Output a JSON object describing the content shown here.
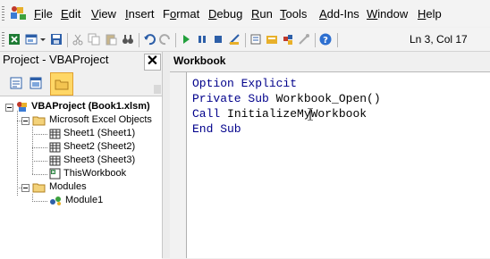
{
  "menubar": {
    "items": [
      {
        "accel": "F",
        "rest": "ile"
      },
      {
        "accel": "E",
        "rest": "dit"
      },
      {
        "accel": "V",
        "rest": "iew"
      },
      {
        "accel": "I",
        "rest": "nsert"
      },
      {
        "prefix": "F",
        "accel": "o",
        "rest": "rmat"
      },
      {
        "accel": "D",
        "rest": "ebug"
      },
      {
        "accel": "R",
        "rest": "un"
      },
      {
        "accel": "T",
        "rest": "ools"
      },
      {
        "prefix": "",
        "accel": "A",
        "rest": "dd-Ins"
      },
      {
        "accel": "W",
        "rest": "indow"
      },
      {
        "accel": "H",
        "rest": "elp"
      }
    ]
  },
  "toolbar": {
    "icons": [
      "excel-icon",
      "insert-userform-icon",
      "dropdown-arrow-icon",
      "save-icon",
      "cut-icon",
      "copy-icon",
      "paste-icon",
      "find-icon",
      "undo-icon",
      "redo-icon",
      "run-icon",
      "break-icon",
      "reset-icon",
      "design-mode-icon",
      "project-explorer-icon",
      "properties-icon",
      "object-browser-icon",
      "toolbox-icon",
      "help-icon"
    ],
    "position": "Ln 3, Col 17"
  },
  "project": {
    "title": "Project - VBAProject",
    "close": "✕",
    "tree": {
      "root": "VBAProject (Book1.xlsm)",
      "excel_objects": "Microsoft Excel Objects",
      "sheets": [
        "Sheet1 (Sheet1)",
        "Sheet2 (Sheet2)",
        "Sheet3 (Sheet3)"
      ],
      "workbook": "ThisWorkbook",
      "modules": "Modules",
      "module1": "Module1"
    }
  },
  "code": {
    "object": "Workbook",
    "lines": [
      {
        "kw": "Option Explicit",
        "rest": ""
      },
      {
        "kw": "Private Sub ",
        "rest": "Workbook_Open()"
      },
      {
        "kw": "Call ",
        "rest": "InitializeMyWorkbook"
      },
      {
        "kw": "End Sub",
        "rest": ""
      }
    ]
  },
  "colors": {
    "keyword": "#00008b",
    "folder": "#ffd766"
  }
}
